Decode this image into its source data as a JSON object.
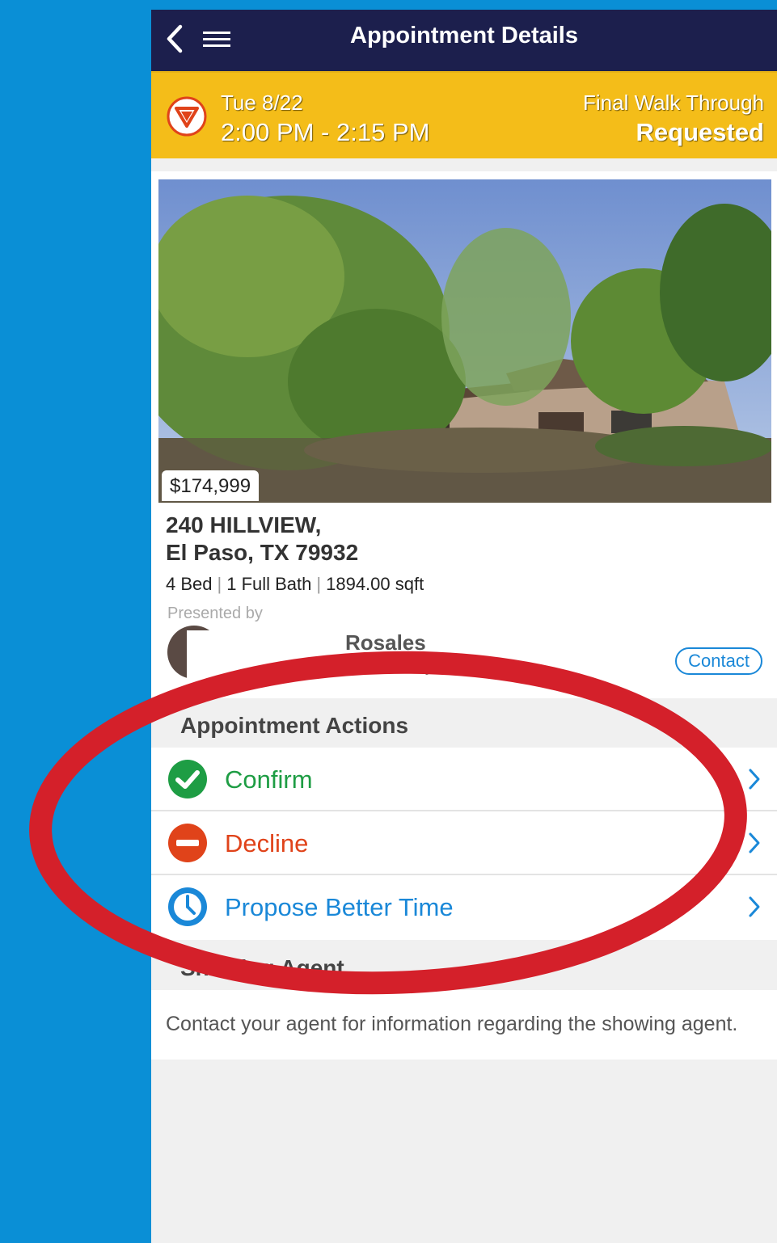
{
  "nav": {
    "title": "Appointment Details",
    "back_icon": "chevron-left-icon",
    "menu_icon": "hamburger-menu-icon"
  },
  "banner": {
    "date": "Tue 8/22",
    "time": "2:00 PM - 2:15 PM",
    "type": "Final Walk Through",
    "status": "Requested",
    "icon": "yield-triangle-icon",
    "color": "#f4bd19"
  },
  "listing": {
    "price": "$174,999",
    "address_line1": "240 HILLVIEW,",
    "address_line2": "El Paso, TX 79932",
    "beds": "4 Bed",
    "baths": "1 Full Bath",
    "sqft": "1894.00 sqft",
    "presented_by": "Presented by",
    "agent_name": "Rosales",
    "agent_office": "liams Realty -FM",
    "contact_label": "Contact"
  },
  "actions": {
    "heading": "Appointment Actions",
    "items": [
      {
        "label": "Confirm",
        "icon": "check-circle-icon",
        "color": "#1e9d44"
      },
      {
        "label": "Decline",
        "icon": "minus-circle-icon",
        "color": "#e0431a"
      },
      {
        "label": "Propose Better Time",
        "icon": "clock-icon",
        "color": "#1a88d8"
      }
    ]
  },
  "showing_agent": {
    "heading": "Showing Agent",
    "message": "Contact your agent for information regarding the showing agent."
  },
  "colors": {
    "background": "#0a8fd6",
    "navbar": "#1c1f4d",
    "annotation": "#d4202a"
  }
}
